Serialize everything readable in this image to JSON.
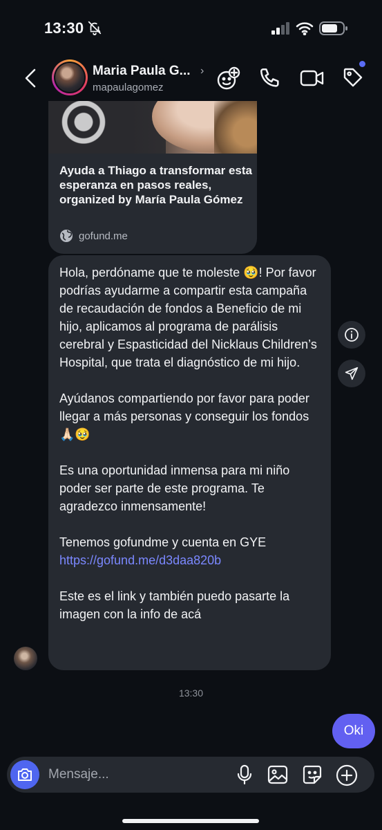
{
  "status_bar": {
    "time": "13:30",
    "icons": [
      "bell-slash-icon",
      "signal-icon",
      "wifi-icon",
      "battery-icon"
    ]
  },
  "header": {
    "contact_name": "Maria Paula G...",
    "username": "mapaulagomez",
    "icons": [
      "back-chevron-icon",
      "add-people-icon",
      "phone-icon",
      "video-icon",
      "tag-icon"
    ]
  },
  "shared_card": {
    "title": "Ayuda a Thiago a transformar esta esperanza en pasos reales, organized by María Paula Gómez",
    "domain": "gofund.me",
    "icon": "globe-icon"
  },
  "message": {
    "p1": "Hola, perdóname que te moleste 🥹! Por favor podrías ayudarme a compartir esta campaña de recaudación de fondos a Beneficio de mi hijo, aplicamos al programa de parálisis cerebral y Espasticidad del Nicklaus Children’s Hospital, que trata el diagnóstico de mi hijo.",
    "p2": "Ayúdanos compartiendo por favor para poder llegar a más personas y conseguir los fondos 🙏🏻🥹",
    "p3": "Es una oportunidad inmensa para mi niño poder ser parte de este programa. Te agradezco inmensamente!",
    "p4": "Tenemos gofundme y cuenta en GYE",
    "link": "https://gofund.me/d3daa820b",
    "p5": "Este es el link y también puedo pasarte la imagen con la info de acá"
  },
  "timestamp": "13:30",
  "sent_message": "Oki",
  "composer": {
    "placeholder": "Mensaje...",
    "icons": [
      "camera-icon",
      "microphone-icon",
      "gallery-icon",
      "sticker-icon",
      "plus-icon"
    ]
  },
  "colors": {
    "background": "#0c0f14",
    "bubble": "#262a31",
    "accent": "#6260f1",
    "link": "#7b88ff",
    "camera": "#4f66f0"
  }
}
